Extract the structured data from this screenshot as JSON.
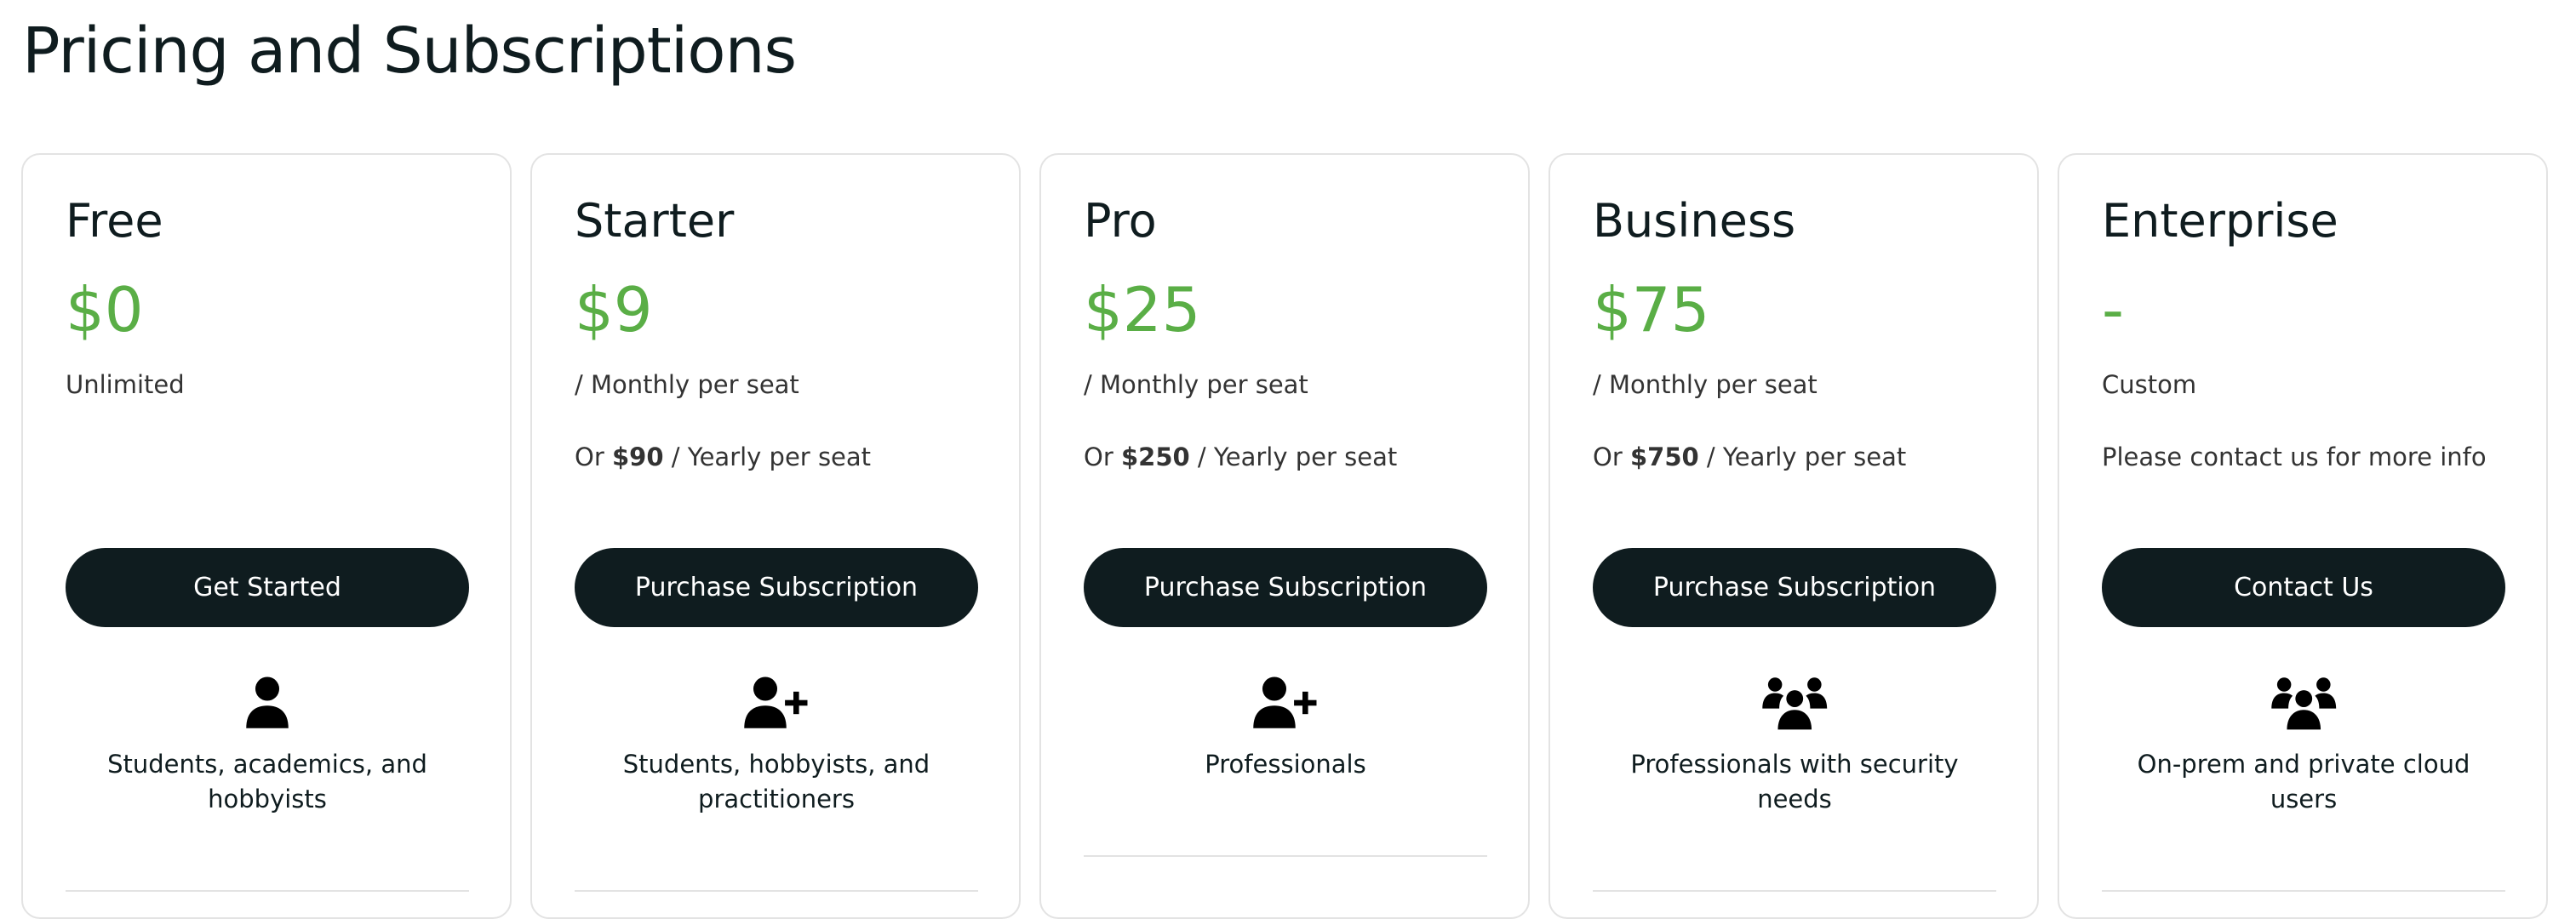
{
  "page": {
    "title": "Pricing and Subscriptions"
  },
  "colors": {
    "price": "#5aae46",
    "button": "#0f1c1f"
  },
  "plans": [
    {
      "name": "Free",
      "price": "$0",
      "period": "Unlimited",
      "yearly_prefix": "",
      "yearly_price": "",
      "yearly_suffix": "",
      "button": "Get Started",
      "icon": "user-icon",
      "audience": "Students, academics, and hobbyists"
    },
    {
      "name": "Starter",
      "price": "$9",
      "period": "/ Monthly per seat",
      "yearly_prefix": "Or ",
      "yearly_price": "$90",
      "yearly_suffix": " / Yearly per seat",
      "button": "Purchase Subscription",
      "icon": "user-plus-icon",
      "audience": "Students, hobbyists, and practitioners"
    },
    {
      "name": "Pro",
      "price": "$25",
      "period": "/ Monthly per seat",
      "yearly_prefix": "Or ",
      "yearly_price": "$250",
      "yearly_suffix": " / Yearly per seat",
      "button": "Purchase Subscription",
      "icon": "user-plus-icon",
      "audience": "Professionals"
    },
    {
      "name": "Business",
      "price": "$75",
      "period": "/ Monthly per seat",
      "yearly_prefix": "Or ",
      "yearly_price": "$750",
      "yearly_suffix": " / Yearly per seat",
      "button": "Purchase Subscription",
      "icon": "users-group-icon",
      "audience": "Professionals with security needs"
    },
    {
      "name": "Enterprise",
      "price": "-",
      "period": "Custom",
      "yearly_prefix": "Please contact us for more info",
      "yearly_price": "",
      "yearly_suffix": "",
      "button": "Contact Us",
      "icon": "users-group-icon",
      "audience": "On-prem and private cloud users"
    }
  ]
}
